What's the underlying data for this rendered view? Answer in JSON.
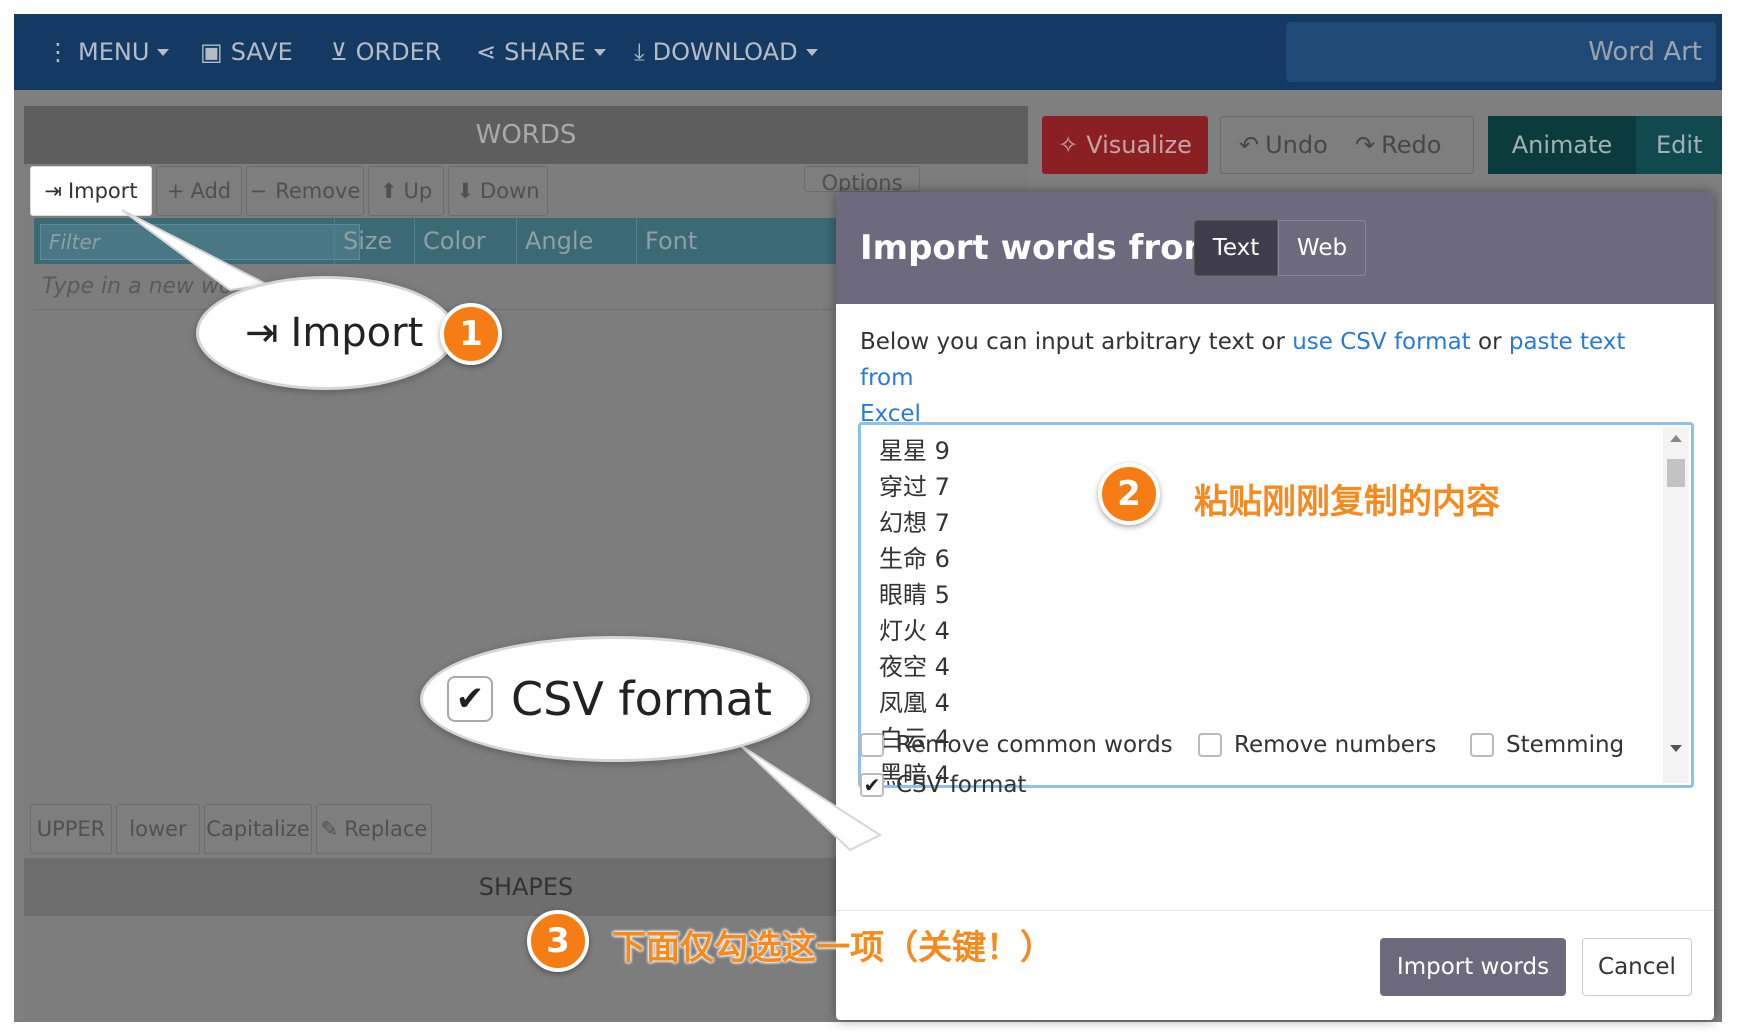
{
  "colors": {
    "accent_red": "#8b2024",
    "teal": "#0c3b3e",
    "modal_header": "#6d6a7e",
    "link": "#2a7ad6",
    "callout_orange": "#f57d14"
  },
  "nav": {
    "menu": "MENU",
    "save": "SAVE",
    "order": "ORDER",
    "share": "SHARE",
    "download": "DOWNLOAD",
    "brand": "Word Art"
  },
  "words_panel": {
    "header": "WORDS",
    "toolbar": {
      "import": "Import",
      "add": "Add",
      "remove": "Remove",
      "up": "Up",
      "down": "Down",
      "options": "Options"
    },
    "columns": {
      "filter_placeholder": "Filter",
      "size": "Size",
      "color": "Color",
      "angle": "Angle",
      "font": "Font"
    },
    "new_word_placeholder": "Type in a new wo",
    "case_buttons": {
      "upper": "UPPER",
      "lower": "lower",
      "capitalize": "Capitalize",
      "replace": "Replace"
    },
    "shapes_header": "SHAPES"
  },
  "right_toolbar": {
    "visualize": "Visualize",
    "undo": "Undo",
    "redo": "Redo",
    "animate": "Animate",
    "edit": "Edit"
  },
  "modal": {
    "title": "Import words from",
    "tabs": {
      "text": "Text",
      "web": "Web"
    },
    "desc_a": "Below you can input arbitrary text or ",
    "desc_link1": "use CSV format",
    "desc_b": " or ",
    "desc_link2": "paste text from",
    "desc_link3": "Excel",
    "words": [
      "星星 9",
      "穿过 7",
      "幻想 7",
      "生命 6",
      "眼睛 5",
      "灯火 4",
      "夜空 4",
      "凤凰 4",
      "白云 4",
      "黑暗 4"
    ],
    "options": {
      "remove_common": "Remove common words",
      "remove_numbers": "Remove numbers",
      "stemming": "Stemming",
      "csv_format": "CSV format"
    },
    "csv_checked": true,
    "import_button": "Import words",
    "cancel_button": "Cancel"
  },
  "callouts": {
    "import_zoom_label": "Import",
    "csv_zoom_label": "CSV format",
    "n1": "1",
    "n2": "2",
    "n3": "3",
    "note2": "粘贴刚刚复制的内容",
    "note3": "下面仅勾选这一项（关键！）"
  }
}
